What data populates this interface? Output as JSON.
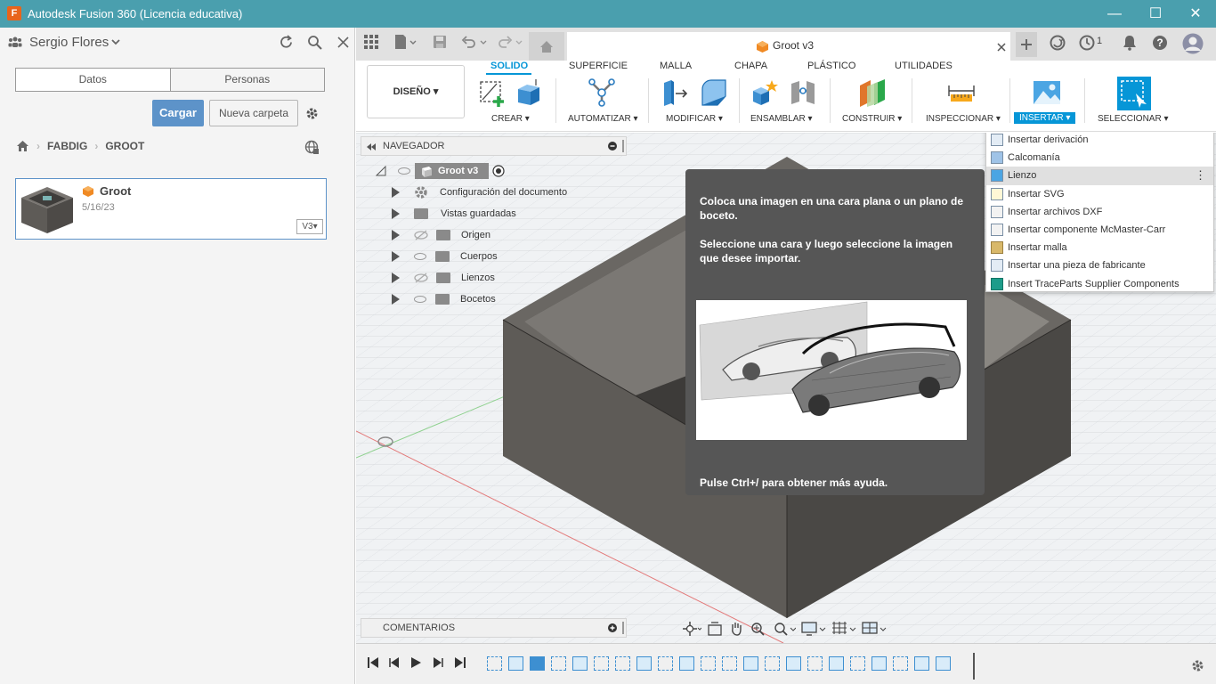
{
  "window": {
    "title": "Autodesk Fusion 360 (Licencia educativa)",
    "app_icon": "F",
    "minimize": "—",
    "maximize": "☐",
    "close": "✕"
  },
  "data_panel": {
    "user": "Sergio Flores",
    "tabs": [
      "Datos",
      "Personas"
    ],
    "upload_label": "Cargar",
    "new_folder_label": "Nueva carpeta",
    "breadcrumb": [
      "FABDIG",
      "GROOT"
    ],
    "file": {
      "name": "Groot",
      "date": "5/16/23",
      "version": "V3▾"
    }
  },
  "document_tab": {
    "name": "Groot v3"
  },
  "top_right": {
    "jobs_count": "1"
  },
  "ribbon": {
    "workspace": "DISEÑO ▾",
    "tabs": [
      "SOLIDO",
      "SUPERFICIE",
      "MALLA",
      "CHAPA",
      "PLÁSTICO",
      "UTILIDADES"
    ],
    "groups": [
      "CREAR ▾",
      "AUTOMATIZAR ▾",
      "MODIFICAR ▾",
      "ENSAMBLAR ▾",
      "CONSTRUIR ▾",
      "INSPECCIONAR ▾",
      "INSERTAR ▾",
      "SELECCIONAR ▾"
    ]
  },
  "browser": {
    "title": "NAVEGADOR",
    "root": "Groot v3",
    "items": [
      "Configuración del documento",
      "Vistas guardadas",
      "Origen",
      "Cuerpos",
      "Lienzos",
      "Bocetos"
    ],
    "comments": "COMENTARIOS"
  },
  "tooltip": {
    "text1": "Coloca una imagen en una cara plana o un plano de boceto.",
    "text2": "Seleccione una cara y luego seleccione la imagen que desee importar.",
    "hint": "Pulse Ctrl+/ para obtener más ayuda."
  },
  "insert_menu": {
    "items": [
      "Insertar derivación",
      "Calcomanía",
      "Lienzo",
      "Insertar SVG",
      "Insertar archivos DXF",
      "Insertar componente McMaster-Carr",
      "Insertar malla",
      "Insertar una pieza de fabricante",
      "Insert TraceParts Supplier Components"
    ],
    "highlighted": "Lienzo"
  },
  "colors": {
    "titlebar": "#4a9fae",
    "accent": "#0696d7",
    "upload_button": "#5d93c9",
    "model_box": "#5e5b57"
  }
}
